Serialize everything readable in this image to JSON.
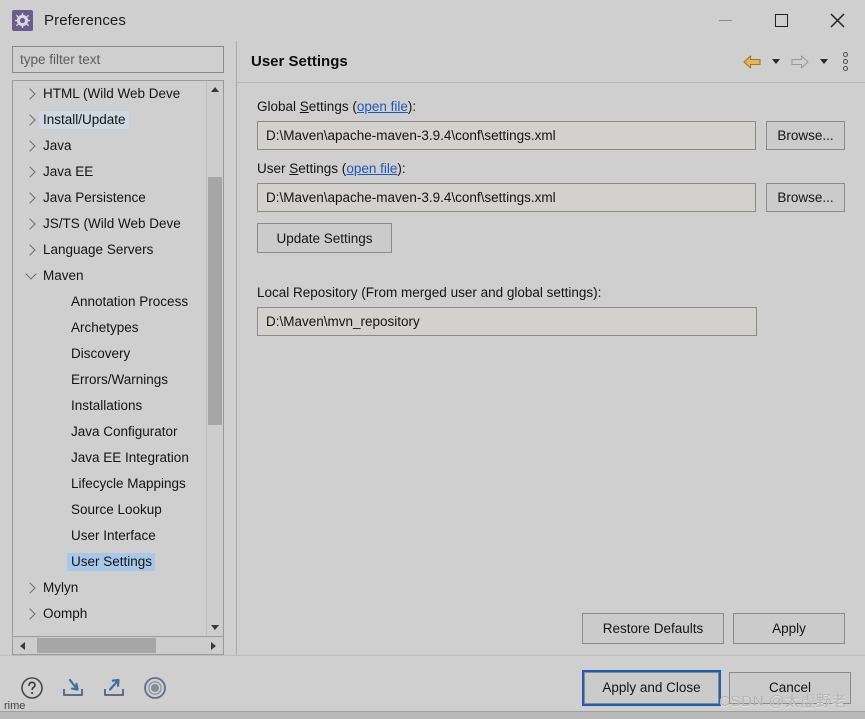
{
  "window": {
    "title": "Preferences",
    "icon": "gear-icon",
    "minimize_label": "Minimize",
    "maximize_label": "Maximize",
    "close_label": "Close"
  },
  "sidebar": {
    "filter_placeholder": "type filter text",
    "items": [
      {
        "label": "HTML (Wild Web Deve",
        "level": 0,
        "expandable": true,
        "expanded": false,
        "state": "normal"
      },
      {
        "label": "Install/Update",
        "level": 0,
        "expandable": true,
        "expanded": false,
        "state": "hover"
      },
      {
        "label": "Java",
        "level": 0,
        "expandable": true,
        "expanded": false,
        "state": "normal"
      },
      {
        "label": "Java EE",
        "level": 0,
        "expandable": true,
        "expanded": false,
        "state": "normal"
      },
      {
        "label": "Java Persistence",
        "level": 0,
        "expandable": true,
        "expanded": false,
        "state": "normal"
      },
      {
        "label": "JS/TS (Wild Web Deve",
        "level": 0,
        "expandable": true,
        "expanded": false,
        "state": "normal"
      },
      {
        "label": "Language Servers",
        "level": 0,
        "expandable": true,
        "expanded": false,
        "state": "normal"
      },
      {
        "label": "Maven",
        "level": 0,
        "expandable": true,
        "expanded": true,
        "state": "normal"
      },
      {
        "label": "Annotation Process",
        "level": 1,
        "expandable": false,
        "expanded": false,
        "state": "normal"
      },
      {
        "label": "Archetypes",
        "level": 1,
        "expandable": false,
        "expanded": false,
        "state": "normal"
      },
      {
        "label": "Discovery",
        "level": 1,
        "expandable": false,
        "expanded": false,
        "state": "normal"
      },
      {
        "label": "Errors/Warnings",
        "level": 1,
        "expandable": false,
        "expanded": false,
        "state": "normal"
      },
      {
        "label": "Installations",
        "level": 1,
        "expandable": false,
        "expanded": false,
        "state": "normal"
      },
      {
        "label": "Java Configurator",
        "level": 1,
        "expandable": false,
        "expanded": false,
        "state": "normal"
      },
      {
        "label": "Java EE Integration",
        "level": 1,
        "expandable": false,
        "expanded": false,
        "state": "normal"
      },
      {
        "label": "Lifecycle Mappings",
        "level": 1,
        "expandable": false,
        "expanded": false,
        "state": "normal"
      },
      {
        "label": "Source Lookup",
        "level": 1,
        "expandable": false,
        "expanded": false,
        "state": "normal"
      },
      {
        "label": "User Interface",
        "level": 1,
        "expandable": false,
        "expanded": false,
        "state": "normal"
      },
      {
        "label": "User Settings",
        "level": 1,
        "expandable": false,
        "expanded": false,
        "state": "selected"
      },
      {
        "label": "Mylyn",
        "level": 0,
        "expandable": true,
        "expanded": false,
        "state": "normal"
      },
      {
        "label": "Oomph",
        "level": 0,
        "expandable": true,
        "expanded": false,
        "state": "normal"
      }
    ]
  },
  "page": {
    "title": "User Settings",
    "nav": {
      "back_icon": "back-arrow-icon",
      "back_caret_icon": "chevron-down-icon",
      "forward_icon": "forward-arrow-icon",
      "forward_caret_icon": "chevron-down-icon",
      "menu_icon": "vertical-dots-icon",
      "back_color": "#c8912c",
      "forward_color": "#9a9a9a"
    },
    "global_settings": {
      "label_prefix": "Global ",
      "label_mnemonic": "S",
      "label_rest": "ettings (",
      "link": "open file",
      "label_suffix": "):",
      "value": "D:\\Maven\\apache-maven-3.9.4\\conf\\settings.xml",
      "browse_label": "Browse..."
    },
    "user_settings": {
      "label_prefix": "User ",
      "label_mnemonic": "S",
      "label_rest": "ettings (",
      "link": "open file",
      "label_suffix": "):",
      "value": "D:\\Maven\\apache-maven-3.9.4\\conf\\settings.xml",
      "browse_label": "Browse..."
    },
    "update_settings_label": "Update Settings",
    "local_repository": {
      "label": "Local Repository (From merged user and global settings):",
      "value": "D:\\Maven\\mvn_repository"
    },
    "restore_defaults_label": "Restore Defaults",
    "apply_label": "Apply"
  },
  "bottom": {
    "help_icon": "help-icon",
    "import_icon": "import-icon",
    "export_icon": "export-icon",
    "target_icon": "target-icon",
    "apply_and_close_label": "Apply and Close",
    "cancel_label": "Cancel",
    "watermark": "CSDN @太虚野老",
    "strip_text": "rime"
  },
  "colors": {
    "selection": "#a7c8e8",
    "hover": "#cdd8e2",
    "link": "#1f58b8",
    "focus_ring": "#1a5fb4",
    "window_bg": "#cfcfcf",
    "back_arrow": "#c8912c"
  }
}
